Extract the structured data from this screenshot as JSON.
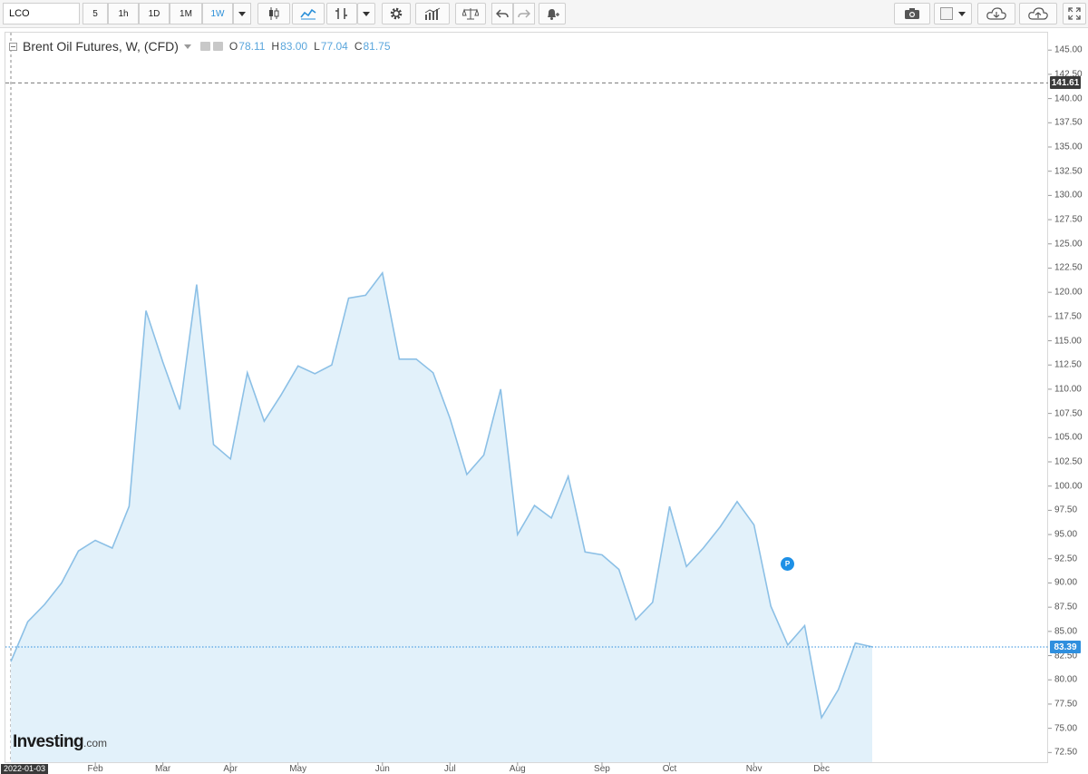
{
  "toolbar": {
    "symbol": "LCO",
    "intervals": [
      "5",
      "1h",
      "1D",
      "1M",
      "1W"
    ],
    "active_interval": "1W",
    "icons": [
      "candles-icon",
      "line-chart-icon",
      "indicator-icon",
      "settings-icon",
      "bars-icon",
      "compare-icon",
      "undo-icon",
      "redo-icon",
      "alert-icon",
      "camera-icon",
      "color-swatch-icon",
      "cloud-download-icon",
      "cloud-upload-icon",
      "fullscreen-icon"
    ]
  },
  "legend": {
    "title": "Brent Oil Futures, W, (CFD)",
    "o_label": "O",
    "o_value": "78.11",
    "h_label": "H",
    "h_value": "83.00",
    "l_label": "L",
    "l_value": "77.04",
    "c_label": "C",
    "c_value": "81.75"
  },
  "markers": {
    "high_price": "141.61",
    "last_price": "83.39",
    "cursor_date": "2022-01-03",
    "event_badge": "P"
  },
  "watermark": {
    "brand": "Investing",
    "suffix": ".com"
  },
  "colors": {
    "line": "#8cc0e6",
    "fill": "#e2f1fa",
    "price_tag": "#2f8fde",
    "high_tag": "#3a3a3a"
  },
  "chart_data": {
    "type": "area",
    "title": "Brent Oil Futures, W, (CFD)",
    "xlabel": "",
    "ylabel": "",
    "ylim": [
      71.5,
      146.8
    ],
    "y_ticks": [
      72.5,
      75.0,
      77.5,
      80.0,
      82.5,
      85.0,
      87.5,
      90.0,
      92.5,
      95.0,
      97.5,
      100.0,
      102.5,
      105.0,
      107.5,
      110.0,
      112.5,
      115.0,
      117.5,
      120.0,
      122.5,
      125.0,
      127.5,
      130.0,
      132.5,
      135.0,
      137.5,
      140.0,
      142.5,
      145.0
    ],
    "x_tick_labels": [
      "Feb",
      "Mar",
      "Apr",
      "May",
      "Jun",
      "Jul",
      "Aug",
      "Sep",
      "Oct",
      "Nov",
      "Dec"
    ],
    "x_tick_week_index": [
      5,
      9,
      13,
      17,
      22,
      26,
      30,
      35,
      39,
      44,
      48
    ],
    "grid": false,
    "series": [
      {
        "values": [
          81.9,
          86.0,
          87.8,
          90.0,
          93.3,
          94.4,
          93.6,
          97.9,
          118.1,
          112.8,
          107.9,
          120.8,
          104.3,
          102.8,
          111.7,
          106.7,
          109.4,
          112.4,
          111.6,
          112.5,
          119.4,
          119.7,
          122.0,
          113.1,
          113.1,
          111.7,
          107.0,
          101.2,
          103.2,
          110.0,
          95.0,
          98.0,
          96.7,
          101.0,
          93.2,
          92.9,
          91.4,
          86.2,
          88.0,
          97.9,
          91.7,
          93.6,
          95.8,
          98.4,
          96.0,
          87.6,
          83.6,
          85.6,
          76.1,
          79.0,
          83.8,
          83.4
        ]
      }
    ],
    "last_value": 83.39,
    "max_marker": 141.61
  }
}
